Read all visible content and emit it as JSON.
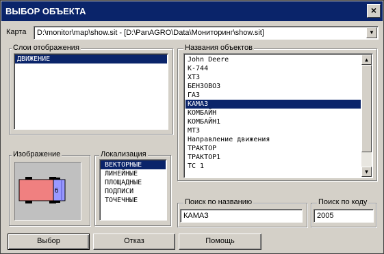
{
  "window": {
    "title": "ВЫБОР ОБЪЕКТА",
    "close_glyph": "×"
  },
  "map": {
    "label": "Карта",
    "value": "D:\\monitor\\map\\show.sit - [D:\\PanAGRO\\Data\\Мониторинг\\show.sit]",
    "dropdown_glyph": "▼"
  },
  "layers": {
    "title": "Слои отображения",
    "items": [
      {
        "label": "ДВИЖЕНИЕ",
        "selected": true
      }
    ]
  },
  "objects": {
    "title": "Названия объектов",
    "items": [
      {
        "label": "John Deere"
      },
      {
        "label": "К-744"
      },
      {
        "label": "ХТЗ"
      },
      {
        "label": "БЕНЗОВОЗ"
      },
      {
        "label": "ГАЗ"
      },
      {
        "label": "КАМАЗ",
        "selected": true
      },
      {
        "label": "КОМБАЙН"
      },
      {
        "label": "КОМБАЙН1"
      },
      {
        "label": "МТЗ"
      },
      {
        "label": "Направление движения"
      },
      {
        "label": "ТРАКТОР"
      },
      {
        "label": "ТРАКТОР1"
      },
      {
        "label": "ТС 1"
      }
    ],
    "scroll_up_glyph": "▲",
    "scroll_down_glyph": "▼"
  },
  "image": {
    "title": "Изображение",
    "icon": "truck-icon",
    "colors": {
      "cab": "#f08080",
      "body": "#9999ff",
      "background": "#c0c0c0"
    }
  },
  "localization": {
    "title": "Локализация",
    "items": [
      {
        "label": "ВЕКТОРНЫЕ",
        "selected": true
      },
      {
        "label": "ЛИНЕЙНЫЕ"
      },
      {
        "label": "ПЛОЩАДНЫЕ"
      },
      {
        "label": "ПОДПИСИ"
      },
      {
        "label": "ТОЧЕЧНЫЕ"
      }
    ]
  },
  "search_name": {
    "title": "Поиск  по названию",
    "value": "КАМАЗ"
  },
  "search_code": {
    "title": "Поиск по коду",
    "value": "2005"
  },
  "buttons": {
    "select": "Выбор",
    "cancel": "Отказ",
    "help": "Помощь"
  },
  "colors": {
    "title_bar": "#0a246a",
    "selection": "#0a246a",
    "face": "#d4d0c8"
  }
}
